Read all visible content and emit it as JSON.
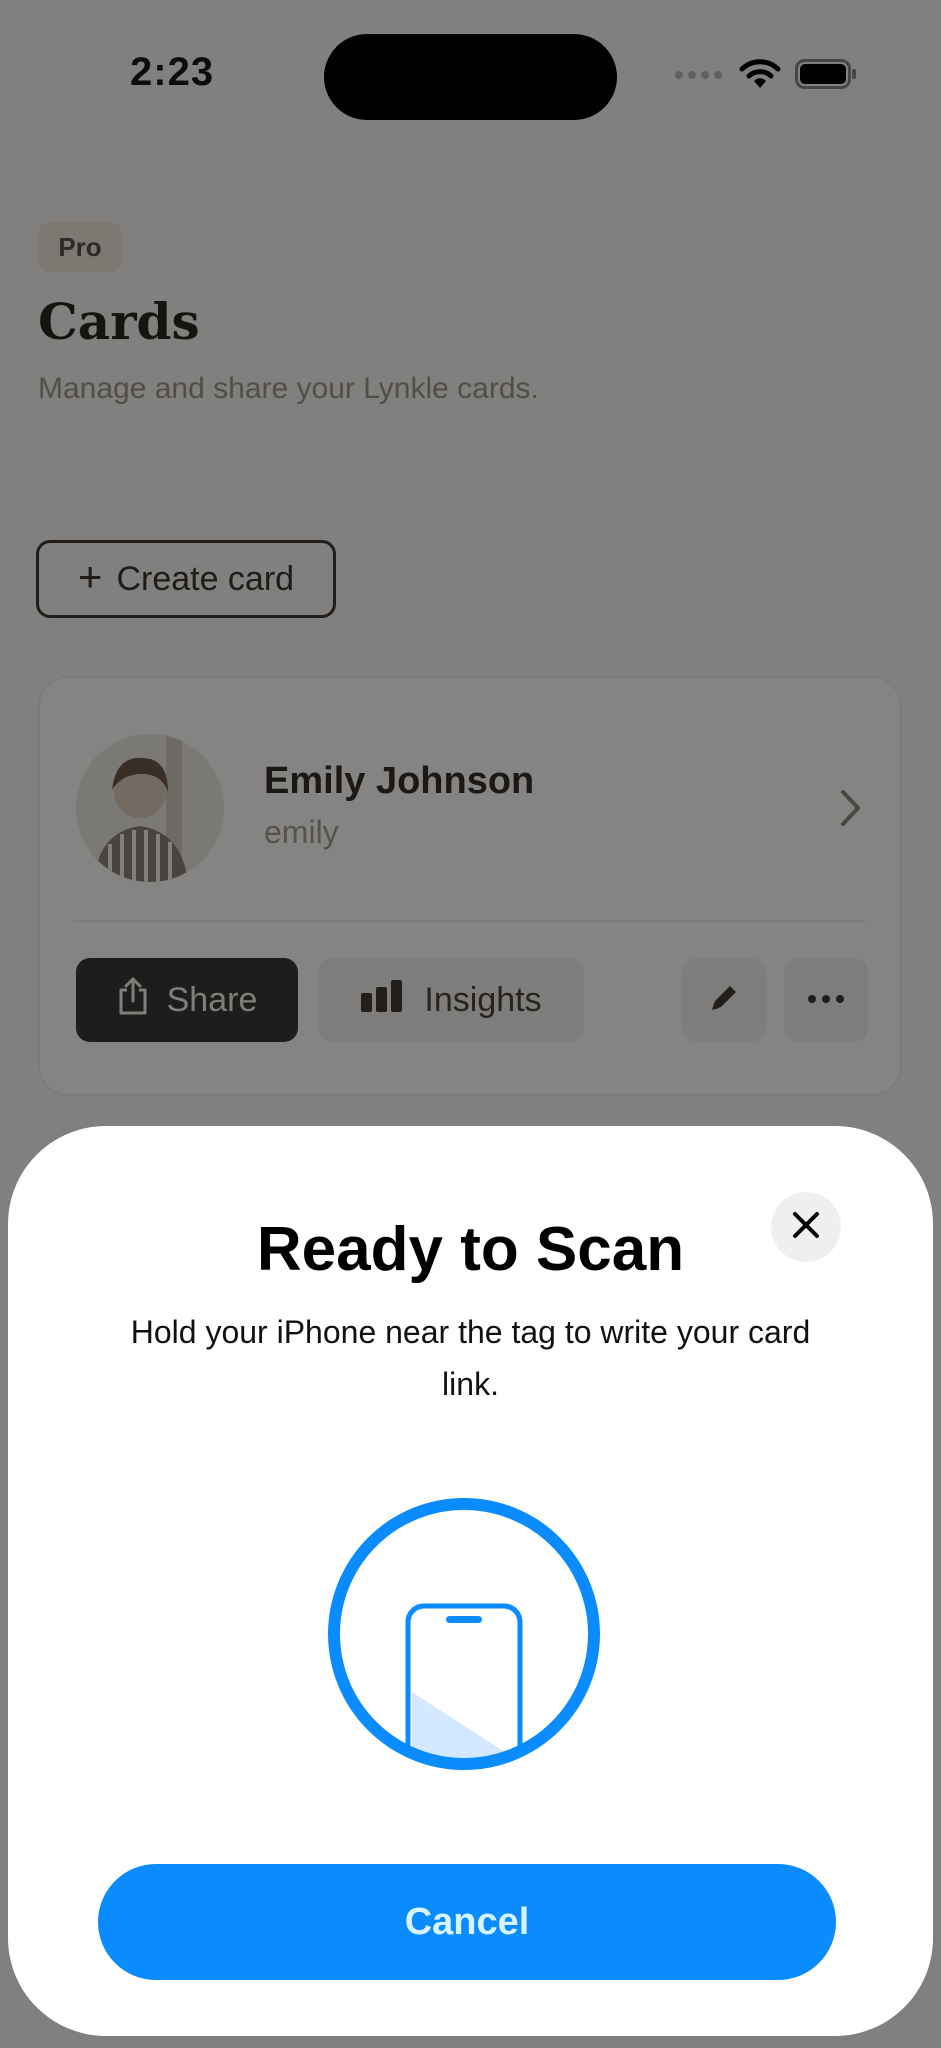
{
  "status_bar": {
    "time": "2:23",
    "icons": [
      "signal-icon",
      "wifi-icon",
      "battery-icon"
    ]
  },
  "header": {
    "badge": "Pro",
    "title": "Cards",
    "subtitle": "Manage and share your Lynkle cards."
  },
  "actions": {
    "create_card_label": "Create card",
    "create_card_icon": "plus-icon"
  },
  "card": {
    "name": "Emily Johnson",
    "handle": "emily",
    "share_label": "Share",
    "insights_label": "Insights",
    "icons": [
      "avatar",
      "chevron-right-icon",
      "share-icon",
      "bar-chart-icon",
      "pencil-icon",
      "more-horizontal-icon"
    ]
  },
  "nfc_sheet": {
    "title": "Ready to Scan",
    "message": "Hold your iPhone near the tag to write your card link.",
    "cancel_label": "Cancel",
    "icons": [
      "close-icon",
      "phone-scan-icon"
    ]
  },
  "colors": {
    "accent_blue": "#0a8cff",
    "share_button_dark": "#3b3733",
    "badge_background": "#ece3d6",
    "page_background": "#f4f2ee"
  }
}
